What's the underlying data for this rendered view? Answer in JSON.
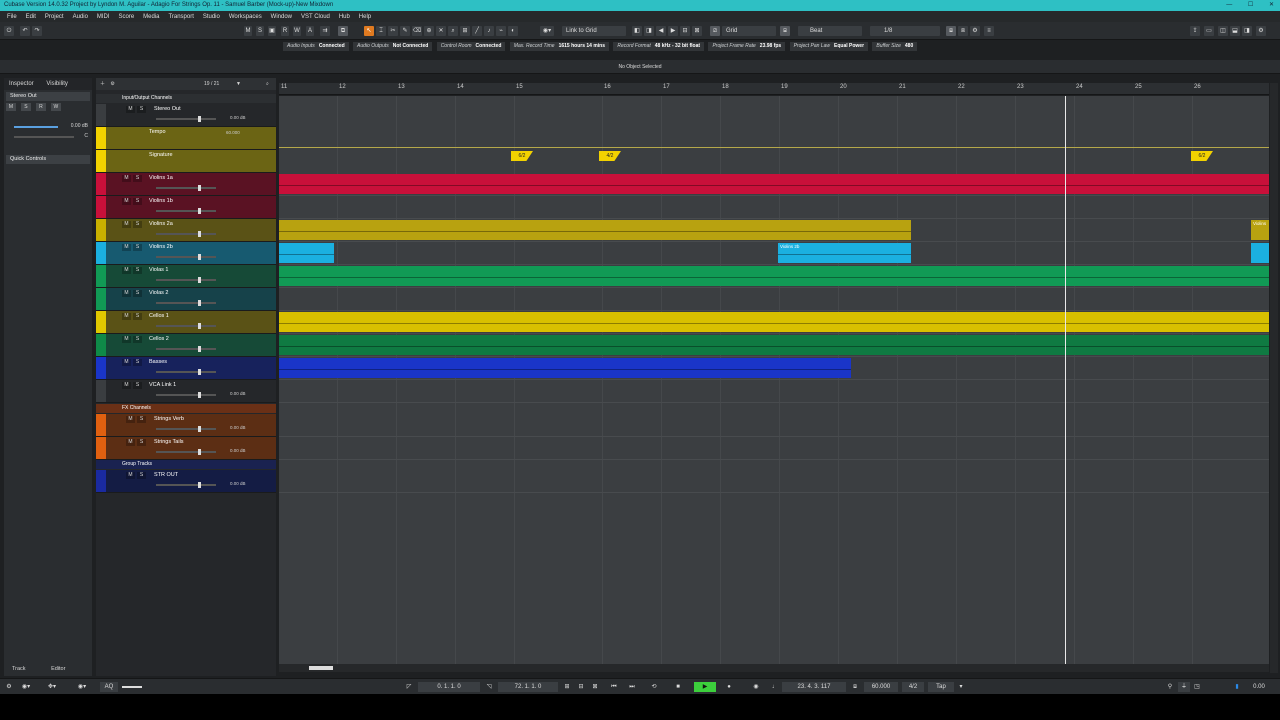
{
  "window": {
    "title": "Cubase Version 14.0.32 Project by Lyndon M. Aguilar - Adagio For Strings Op. 11 - Samuel Barber (Mock-up)-New Mixdown"
  },
  "menu": [
    "File",
    "Edit",
    "Project",
    "Audio",
    "MIDI",
    "Score",
    "Media",
    "Transport",
    "Studio",
    "Workspaces",
    "Window",
    "VST Cloud",
    "Hub",
    "Help"
  ],
  "toolbar": {
    "msrwa": [
      "M",
      "S",
      "R",
      "W",
      "A"
    ],
    "snap_mode": "Link to Grid",
    "grid_type": "Grid",
    "quantize_type": "Beat",
    "quantize_value": "1/8"
  },
  "statusline": [
    {
      "label": "Audio Inputs",
      "value": "Connected"
    },
    {
      "label": "Audio Outputs",
      "value": "Not Connected"
    },
    {
      "label": "Control Room",
      "value": "Connected"
    },
    {
      "label": "Max. Record Time",
      "value": "1615 hours 14 mins"
    },
    {
      "label": "Record Format",
      "value": "48 kHz - 32 bit float"
    },
    {
      "label": "Project Frame Rate",
      "value": "23.98 fps"
    },
    {
      "label": "Project Pan Law",
      "value": "Equal Power"
    },
    {
      "label": "Buffer Size",
      "value": "480"
    }
  ],
  "infoline": "No Object Selected",
  "inspector": {
    "tabs": [
      "Inspector",
      "Visibility"
    ],
    "channel": "Stereo Out",
    "buttons": [
      "M",
      "S",
      "R",
      "W"
    ],
    "volume": "0.00 dB",
    "pan": "C",
    "quick_controls": "Quick Controls",
    "bottom_tabs": [
      "Track",
      "Editor"
    ]
  },
  "tracklist": {
    "counter": "19 / 21",
    "folder_io": "Input/Output Channels",
    "folder_fx": "FX Channels",
    "folder_group": "Group Tracks",
    "tracks": [
      {
        "name": "Stereo Out",
        "vol": "0.00 dB",
        "color": "#3a3d40"
      },
      {
        "name": "Tempo",
        "vol": "60.000",
        "color": "#f2d200"
      },
      {
        "name": "Signature",
        "vol": "",
        "color": "#f2d200"
      },
      {
        "name": "Violins 1a",
        "vol": "",
        "color": "#c8103a"
      },
      {
        "name": "Violins 1b",
        "vol": "",
        "color": "#c8103a"
      },
      {
        "name": "Violins 2a",
        "vol": "",
        "color": "#c8b000"
      },
      {
        "name": "Violins 2b",
        "vol": "",
        "color": "#1bb0e0"
      },
      {
        "name": "Violas 1",
        "vol": "",
        "color": "#119a55"
      },
      {
        "name": "Violas 2",
        "vol": "",
        "color": "#119a55"
      },
      {
        "name": "Cellos 1",
        "vol": "",
        "color": "#e0c800"
      },
      {
        "name": "Cellos 2",
        "vol": "",
        "color": "#0f8a48"
      },
      {
        "name": "Basses",
        "vol": "",
        "color": "#1a35c8"
      },
      {
        "name": "VCA Link 1",
        "vol": "0.00 dB",
        "color": "#3a3d40"
      },
      {
        "name": "Strings Verb",
        "vol": "0.00 dB",
        "color": "#e06010"
      },
      {
        "name": "Strings Tails",
        "vol": "0.00 dB",
        "color": "#e06010"
      },
      {
        "name": "STR OUT",
        "vol": "0.00 dB",
        "color": "#1a2aa0"
      }
    ]
  },
  "ruler": [
    "11",
    "12",
    "13",
    "14",
    "15",
    "16",
    "17",
    "18",
    "19",
    "20",
    "21",
    "22",
    "23",
    "24",
    "25",
    "26"
  ],
  "signatures": [
    "6/2",
    "4/2",
    "6/2"
  ],
  "clip_labels": {
    "violins2b": "Violins 2b",
    "violins2a_end": "Violins"
  },
  "transport": {
    "left_locator": "0. 1. 1.   0",
    "right_locator": "72. 1. 1.   0",
    "position": "23. 4. 3. 117",
    "tempo": "60.000",
    "signature": "4/2",
    "tap": "Tap",
    "aq": "AQ",
    "level": "0.00"
  }
}
